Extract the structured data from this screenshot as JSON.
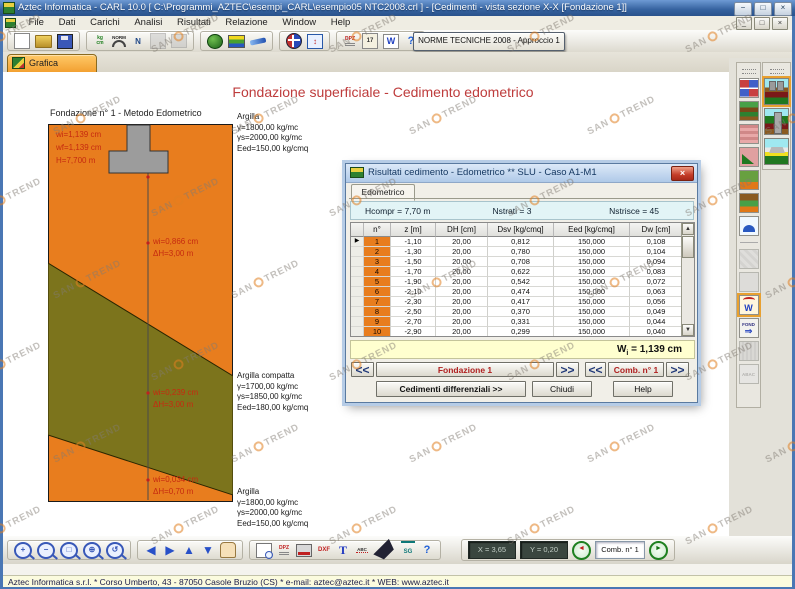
{
  "window": {
    "title": "Aztec Informatica - CARL 10.0 [ C:\\Programmi_AZTEC\\esempi_CARL\\esempio05 NTC2008.crl ] - [Cedimenti - vista sezione X-X [Fondazione 1]]",
    "statusbar": "Aztec Informatica s.r.l. * Corso Umberto, 43 - 87050 Casole Bruzio (CS) * e-mail: aztec@aztec.it * WEB: www.aztec.it",
    "controls": {
      "minimize": "−",
      "maximize": "□",
      "close": "×"
    },
    "mdi_controls": {
      "minimize": "_",
      "restore": "□",
      "close": "×"
    }
  },
  "menu": {
    "items": [
      "File",
      "Dati",
      "Carichi",
      "Analisi",
      "Risultati",
      "Relazione",
      "Window",
      "Help"
    ]
  },
  "toolbar_top": {
    "norme_button": "NORME TECNICHE 2008 - Approccio 1",
    "groups": [
      [
        {
          "name": "new-file-icon",
          "cls": "ic-page"
        },
        {
          "name": "open-folder-icon",
          "cls": "ic-folder"
        },
        {
          "name": "save-icon",
          "cls": "ic-save"
        }
      ],
      [
        {
          "name": "units-kgcm-icon",
          "cls": "ic-kgcm",
          "text": "kg\ncm"
        },
        {
          "name": "norm-binoculars-icon",
          "cls": "ic-norm",
          "text": "NORM"
        },
        {
          "name": "load-n-icon",
          "cls": "ic-n",
          "text": "N"
        },
        {
          "name": "slider-icon",
          "cls": "ic-graybar",
          "disabled": true
        },
        {
          "name": "stop-icon",
          "cls": "ic-grayrect",
          "disabled": true
        }
      ],
      [
        {
          "name": "vegetation-icon",
          "cls": "ic-sphere"
        },
        {
          "name": "soil-layers-icon",
          "cls": "ic-layers"
        },
        {
          "name": "section-line-icon",
          "cls": "ic-plane"
        }
      ],
      [
        {
          "name": "globe-icon",
          "cls": "ic-globe"
        },
        {
          "name": "window-update-icon",
          "cls": "ic-winupd",
          "text": "↕"
        }
      ],
      [
        {
          "name": "dpz-export-icon",
          "cls": "ic-dpz",
          "text": "DPZ"
        },
        {
          "name": "computation-time-icon",
          "cls": "ic-timer",
          "text": "17"
        },
        {
          "name": "word-export-icon",
          "cls": "ic-word",
          "text": "W"
        },
        {
          "name": "help-icon",
          "cls": "ic-help",
          "text": "?"
        }
      ]
    ]
  },
  "tab": {
    "label": "Grafica"
  },
  "canvas": {
    "main_title": "Fondazione superficiale - Cedimento edometrico",
    "drawing_title": "Fondazione n° 1 - Metodo Edometrico",
    "info_lines": [
      "wi=1,139 cm",
      "wf=1,139 cm",
      "H=7,700 m"
    ],
    "axis_labels": [
      {
        "l1": "wi=0,866 cm",
        "l2": "ΔH=3,00 m"
      },
      {
        "l1": "wi=0,239 cm",
        "l2": "ΔH=3,00 m"
      },
      {
        "l1": "wi=0,034 cm",
        "l2": "ΔH=0,70 m"
      }
    ],
    "soil_labels": [
      {
        "name": "Argilla",
        "lines": [
          "γ=1800,00 kg/mc",
          "γs=2000,00 kg/mc",
          "Eed=150,00 kg/cmq"
        ]
      },
      {
        "name": "Argilla compatta",
        "lines": [
          "γ=1700,00 kg/mc",
          "γs=1850,00 kg/mc",
          "Eed=180,00 kg/cmq"
        ]
      },
      {
        "name": "Argilla",
        "lines": [
          "γ=1800,00 kg/mc",
          "γs=2000,00 kg/mc",
          "Eed=150,00 kg/cmq"
        ]
      }
    ]
  },
  "dialog": {
    "title": "Risultati cedimento - Edometrico ** SLU - Caso A1-M1",
    "close": "×",
    "tab": "Edometrico",
    "info": {
      "hcompr": "Hcompr = 7,70 m",
      "nstrati": "Nstrati = 3",
      "nstrisce": "Nstrisce = 45"
    },
    "table": {
      "headers": [
        "n°",
        "z [m]",
        "DH [cm]",
        "Dsv [kg/cmq]",
        "Eed [kg/cmq]",
        "Dw [cm]"
      ],
      "rows": [
        [
          "1",
          "-1,10",
          "20,00",
          "0,812",
          "150,000",
          "0,108"
        ],
        [
          "2",
          "-1,30",
          "20,00",
          "0,780",
          "150,000",
          "0,104"
        ],
        [
          "3",
          "-1,50",
          "20,00",
          "0,708",
          "150,000",
          "0,094"
        ],
        [
          "4",
          "-1,70",
          "20,00",
          "0,622",
          "150,000",
          "0,083"
        ],
        [
          "5",
          "-1,90",
          "20,00",
          "0,542",
          "150,000",
          "0,072"
        ],
        [
          "6",
          "-2,10",
          "20,00",
          "0,474",
          "150,000",
          "0,063"
        ],
        [
          "7",
          "-2,30",
          "20,00",
          "0,417",
          "150,000",
          "0,056"
        ],
        [
          "8",
          "-2,50",
          "20,00",
          "0,370",
          "150,000",
          "0,049"
        ],
        [
          "9",
          "-2,70",
          "20,00",
          "0,331",
          "150,000",
          "0,044"
        ],
        [
          "10",
          "-2,90",
          "20,00",
          "0,299",
          "150,000",
          "0,040"
        ]
      ]
    },
    "result": {
      "symbol": "W",
      "sub": "i",
      "value": " = 1,139 cm"
    },
    "nav": {
      "prev": "<<",
      "next": ">>",
      "fondazione": "Fondazione 1",
      "comb": "Comb. n° 1"
    },
    "buttons": {
      "differenziali": "Cedimenti differenziali >>",
      "chiudi": "Chiudi",
      "help": "Help"
    }
  },
  "toolbar_bottom": {
    "groups": [
      [
        {
          "name": "zoom-in-icon",
          "cls": "mag",
          "text": "+"
        },
        {
          "name": "zoom-out-icon",
          "cls": "mag",
          "text": "−"
        },
        {
          "name": "zoom-page-icon",
          "cls": "mag",
          "text": "□"
        },
        {
          "name": "zoom-extents-icon",
          "cls": "mag",
          "text": "⊕"
        },
        {
          "name": "zoom-previous-icon",
          "cls": "mag",
          "text": "↺"
        }
      ],
      [
        {
          "name": "pan-left-icon",
          "cls": "arr",
          "text": "◀"
        },
        {
          "name": "pan-right-icon",
          "cls": "arr",
          "text": "▶"
        },
        {
          "name": "pan-up-icon",
          "cls": "arr",
          "text": "▲"
        },
        {
          "name": "pan-down-icon",
          "cls": "arr",
          "text": "▼"
        },
        {
          "name": "pan-hand-icon",
          "cls": "hand"
        }
      ],
      [
        {
          "name": "print-preview-icon",
          "cls": "ic-prevw"
        },
        {
          "name": "dpz-icon",
          "cls": "ic-dpz",
          "text": "DPZ"
        },
        {
          "name": "plot-icon",
          "cls": "ic-plot"
        },
        {
          "name": "dxf-export-icon",
          "cls": "ic-dxf",
          "text": "DXF"
        },
        {
          "name": "text-icon",
          "cls": "ic-t",
          "text": "T"
        },
        {
          "name": "spell-abc-icon",
          "cls": "ic-abc",
          "text": "ABC"
        },
        {
          "name": "pen-icon",
          "cls": "ic-pen"
        },
        {
          "name": "sg-icon",
          "cls": "ic-sg",
          "text": "SG"
        },
        {
          "name": "help-icon",
          "cls": "ic-help",
          "text": "?"
        }
      ]
    ],
    "x_display": "X = 3,65",
    "y_display": "Y = 0,20",
    "comb_display": "Comb. n° 1",
    "prev_glyph": "◄",
    "next_glyph": "►"
  },
  "right_toolbar": {
    "strip1": [
      {
        "name": "materials-palette-icon",
        "cls": "ic-r-palette"
      },
      {
        "name": "stratigraphy-icon",
        "cls": "ic-r-strat"
      },
      {
        "name": "soil-texture-icon",
        "cls": "ic-r-soil"
      },
      {
        "name": "excavation-icon",
        "cls": "ic-r-excav"
      },
      {
        "name": "gravel-layer-icon",
        "cls": "ic-r-gravel"
      },
      {
        "name": "embankment-icon",
        "cls": "ic-r-embank"
      },
      {
        "name": "load-plate-icon",
        "cls": "ic-r-plate"
      },
      {
        "divider": true
      },
      {
        "name": "section-tool-icon",
        "cls": "ic-r-dis1",
        "disabled": true
      },
      {
        "name": "mesh-tool-icon",
        "cls": "ic-r-dis2",
        "disabled": true
      },
      {
        "name": "settlement-w-icon",
        "cls": "ic-r-w",
        "text": "W",
        "active": true
      },
      {
        "name": "fond-nav-icon",
        "cls": "ic-r-fond",
        "text": "FOND"
      },
      {
        "name": "texture-map-icon",
        "cls": "ic-r-tex",
        "disabled": true
      },
      {
        "name": "abac-icon",
        "cls": "ic-r-abac",
        "text": "ABAC",
        "disabled": true
      }
    ],
    "strip2": [
      {
        "name": "foundation-plinth-icon",
        "cls": "ic-f-plinth",
        "selected": true
      },
      {
        "name": "foundation-pile-icon",
        "cls": "ic-f-pile"
      },
      {
        "name": "foundation-strip-icon",
        "cls": "ic-f-footing"
      }
    ]
  },
  "watermark": {
    "word1": "SAN",
    "word2": "TREND"
  },
  "colors": {
    "orange": "#E87D1E",
    "olive": "#7C741C",
    "accent_red": "#C62A10",
    "titlebar_blue": "#35629F"
  }
}
